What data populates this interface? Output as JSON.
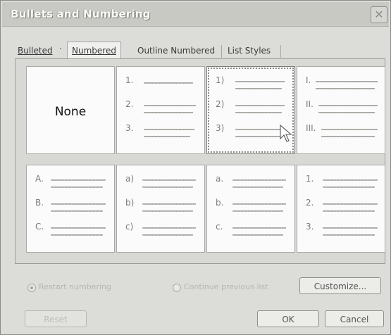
{
  "window": {
    "title": "Bullets and Numbering",
    "close_glyph": "✕"
  },
  "tabs": [
    {
      "label": "Bulleted",
      "active": false
    },
    {
      "label": "Numbered",
      "active": true
    },
    {
      "label": "Outline Numbered",
      "active": false
    },
    {
      "label": "List Styles",
      "active": false
    }
  ],
  "gallery": {
    "cells": [
      {
        "type": "none",
        "label": "None",
        "markers": []
      },
      {
        "type": "list",
        "markers": [
          "1.",
          "2.",
          "3."
        ]
      },
      {
        "type": "list",
        "markers": [
          "1)",
          "2)",
          "3)"
        ],
        "selected": true
      },
      {
        "type": "list",
        "markers": [
          "I.",
          "II.",
          "III."
        ]
      },
      {
        "type": "list",
        "markers": [
          "A.",
          "B.",
          "C."
        ]
      },
      {
        "type": "list",
        "markers": [
          "a)",
          "b)",
          "c)"
        ]
      },
      {
        "type": "list",
        "markers": [
          "a.",
          "b.",
          "c."
        ]
      },
      {
        "type": "list",
        "markers": [
          "1.",
          "2.",
          "3."
        ]
      }
    ]
  },
  "options": {
    "restart_label": "Restart numbering",
    "continue_label": "Continue previous list"
  },
  "buttons": {
    "customize": "Customize...",
    "reset": "Reset",
    "ok": "OK",
    "cancel": "Cancel"
  },
  "colors": {
    "window_bg": "#dcdcd8",
    "preview_bg": "#fbfbfb",
    "selection_outline": "#8b8b87"
  },
  "icons": {
    "close": "close-icon",
    "pointer": "mouse-pointer-icon"
  }
}
